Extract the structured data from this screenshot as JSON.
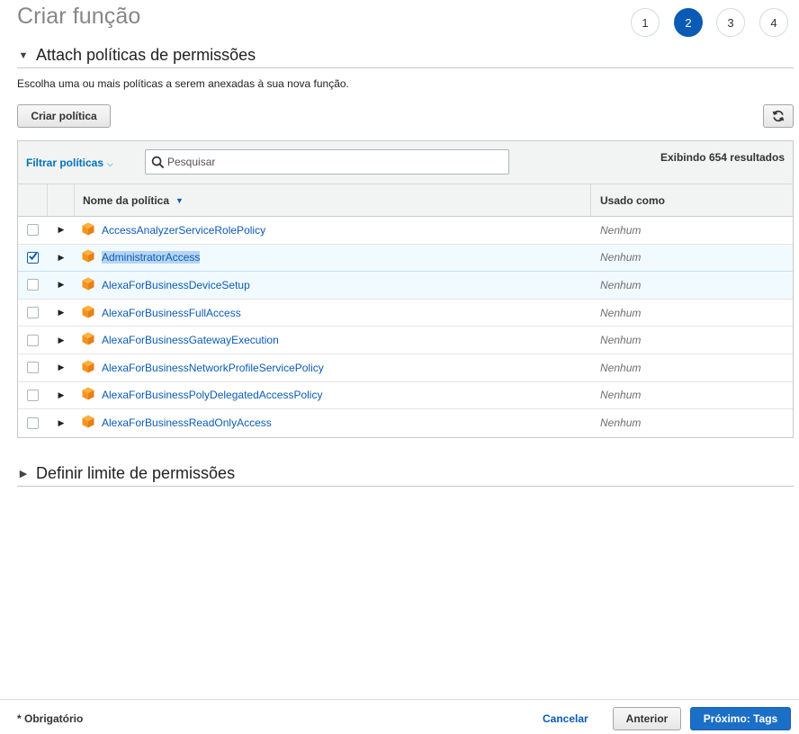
{
  "page": {
    "title": "Criar função",
    "steps": [
      "1",
      "2",
      "3",
      "4"
    ],
    "active_step": "2"
  },
  "section_attach": {
    "title": "Attach políticas de permissões",
    "caret_icon": "caret-down-icon",
    "description": "Escolha uma ou mais políticas a serem anexadas à sua nova função.",
    "create_button": "Criar política",
    "refresh_icon": "refresh-icon"
  },
  "table": {
    "filter_label": "Filtrar políticas",
    "search_placeholder": "Pesquisar",
    "results_text": "Exibindo 654 resultados",
    "columns": [
      "Nome da política",
      "Usado como"
    ],
    "rows": [
      {
        "name": "AccessAnalyzerServiceRolePolicy",
        "used_as": "Nenhum",
        "checked": false
      },
      {
        "name": "AdministratorAccess",
        "used_as": "Nenhum",
        "checked": true
      },
      {
        "name": "AlexaForBusinessDeviceSetup",
        "used_as": "Nenhum",
        "checked": false
      },
      {
        "name": "AlexaForBusinessFullAccess",
        "used_as": "Nenhum",
        "checked": false
      },
      {
        "name": "AlexaForBusinessGatewayExecution",
        "used_as": "Nenhum",
        "checked": false
      },
      {
        "name": "AlexaForBusinessNetworkProfileServicePolicy",
        "used_as": "Nenhum",
        "checked": false
      },
      {
        "name": "AlexaForBusinessPolyDelegatedAccessPolicy",
        "used_as": "Nenhum",
        "checked": false
      },
      {
        "name": "AlexaForBusinessReadOnlyAccess",
        "used_as": "Nenhum",
        "checked": false
      }
    ]
  },
  "section_boundary": {
    "title": "Definir limite de permissões",
    "caret_icon": "caret-right-icon"
  },
  "footer": {
    "required_note": "* Obrigatório",
    "cancel_label": "Cancelar",
    "prev_label": "Anterior",
    "next_label": "Próximo: Tags"
  },
  "colors": {
    "accent": "#0a5bb5",
    "primary_button": "#1b6fc6",
    "selected_row": "#f1faff",
    "policy_icon": "#f7931e"
  }
}
